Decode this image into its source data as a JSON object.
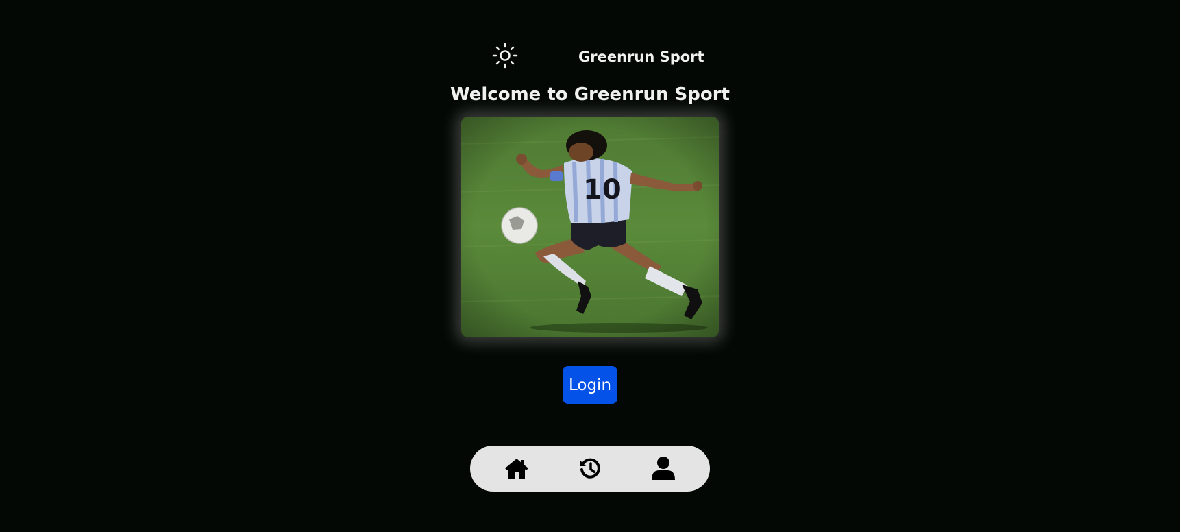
{
  "header": {
    "theme_toggle_icon": "sun-icon",
    "brand": "Greenrun Sport"
  },
  "main": {
    "welcome": "Welcome to Greenrun Sport",
    "hero_image": "soccer-player-photo",
    "jersey_number": "10",
    "login_label": "Login"
  },
  "bottom_nav": {
    "items": [
      {
        "icon": "home-icon"
      },
      {
        "icon": "history-icon"
      },
      {
        "icon": "user-icon"
      }
    ]
  },
  "colors": {
    "background": "#040804",
    "text": "#f0f0f0",
    "accent": "#0552e8",
    "nav_background": "#e4e4e4"
  }
}
